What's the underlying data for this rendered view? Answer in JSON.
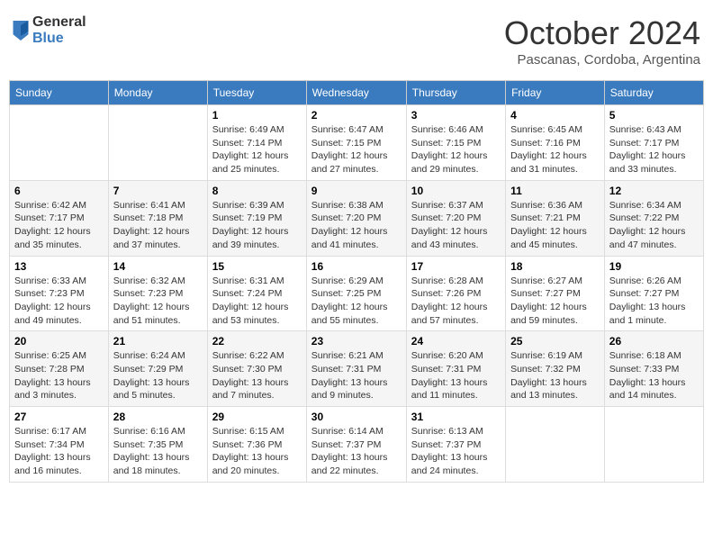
{
  "header": {
    "logo_general": "General",
    "logo_blue": "Blue",
    "month_title": "October 2024",
    "location": "Pascanas, Cordoba, Argentina"
  },
  "days_of_week": [
    "Sunday",
    "Monday",
    "Tuesday",
    "Wednesday",
    "Thursday",
    "Friday",
    "Saturday"
  ],
  "weeks": [
    [
      {
        "day": "",
        "info": ""
      },
      {
        "day": "",
        "info": ""
      },
      {
        "day": "1",
        "sunrise": "6:49 AM",
        "sunset": "7:14 PM",
        "daylight": "12 hours and 25 minutes."
      },
      {
        "day": "2",
        "sunrise": "6:47 AM",
        "sunset": "7:15 PM",
        "daylight": "12 hours and 27 minutes."
      },
      {
        "day": "3",
        "sunrise": "6:46 AM",
        "sunset": "7:15 PM",
        "daylight": "12 hours and 29 minutes."
      },
      {
        "day": "4",
        "sunrise": "6:45 AM",
        "sunset": "7:16 PM",
        "daylight": "12 hours and 31 minutes."
      },
      {
        "day": "5",
        "sunrise": "6:43 AM",
        "sunset": "7:17 PM",
        "daylight": "12 hours and 33 minutes."
      }
    ],
    [
      {
        "day": "6",
        "sunrise": "6:42 AM",
        "sunset": "7:17 PM",
        "daylight": "12 hours and 35 minutes."
      },
      {
        "day": "7",
        "sunrise": "6:41 AM",
        "sunset": "7:18 PM",
        "daylight": "12 hours and 37 minutes."
      },
      {
        "day": "8",
        "sunrise": "6:39 AM",
        "sunset": "7:19 PM",
        "daylight": "12 hours and 39 minutes."
      },
      {
        "day": "9",
        "sunrise": "6:38 AM",
        "sunset": "7:20 PM",
        "daylight": "12 hours and 41 minutes."
      },
      {
        "day": "10",
        "sunrise": "6:37 AM",
        "sunset": "7:20 PM",
        "daylight": "12 hours and 43 minutes."
      },
      {
        "day": "11",
        "sunrise": "6:36 AM",
        "sunset": "7:21 PM",
        "daylight": "12 hours and 45 minutes."
      },
      {
        "day": "12",
        "sunrise": "6:34 AM",
        "sunset": "7:22 PM",
        "daylight": "12 hours and 47 minutes."
      }
    ],
    [
      {
        "day": "13",
        "sunrise": "6:33 AM",
        "sunset": "7:23 PM",
        "daylight": "12 hours and 49 minutes."
      },
      {
        "day": "14",
        "sunrise": "6:32 AM",
        "sunset": "7:23 PM",
        "daylight": "12 hours and 51 minutes."
      },
      {
        "day": "15",
        "sunrise": "6:31 AM",
        "sunset": "7:24 PM",
        "daylight": "12 hours and 53 minutes."
      },
      {
        "day": "16",
        "sunrise": "6:29 AM",
        "sunset": "7:25 PM",
        "daylight": "12 hours and 55 minutes."
      },
      {
        "day": "17",
        "sunrise": "6:28 AM",
        "sunset": "7:26 PM",
        "daylight": "12 hours and 57 minutes."
      },
      {
        "day": "18",
        "sunrise": "6:27 AM",
        "sunset": "7:27 PM",
        "daylight": "12 hours and 59 minutes."
      },
      {
        "day": "19",
        "sunrise": "6:26 AM",
        "sunset": "7:27 PM",
        "daylight": "13 hours and 1 minute."
      }
    ],
    [
      {
        "day": "20",
        "sunrise": "6:25 AM",
        "sunset": "7:28 PM",
        "daylight": "13 hours and 3 minutes."
      },
      {
        "day": "21",
        "sunrise": "6:24 AM",
        "sunset": "7:29 PM",
        "daylight": "13 hours and 5 minutes."
      },
      {
        "day": "22",
        "sunrise": "6:22 AM",
        "sunset": "7:30 PM",
        "daylight": "13 hours and 7 minutes."
      },
      {
        "day": "23",
        "sunrise": "6:21 AM",
        "sunset": "7:31 PM",
        "daylight": "13 hours and 9 minutes."
      },
      {
        "day": "24",
        "sunrise": "6:20 AM",
        "sunset": "7:31 PM",
        "daylight": "13 hours and 11 minutes."
      },
      {
        "day": "25",
        "sunrise": "6:19 AM",
        "sunset": "7:32 PM",
        "daylight": "13 hours and 13 minutes."
      },
      {
        "day": "26",
        "sunrise": "6:18 AM",
        "sunset": "7:33 PM",
        "daylight": "13 hours and 14 minutes."
      }
    ],
    [
      {
        "day": "27",
        "sunrise": "6:17 AM",
        "sunset": "7:34 PM",
        "daylight": "13 hours and 16 minutes."
      },
      {
        "day": "28",
        "sunrise": "6:16 AM",
        "sunset": "7:35 PM",
        "daylight": "13 hours and 18 minutes."
      },
      {
        "day": "29",
        "sunrise": "6:15 AM",
        "sunset": "7:36 PM",
        "daylight": "13 hours and 20 minutes."
      },
      {
        "day": "30",
        "sunrise": "6:14 AM",
        "sunset": "7:37 PM",
        "daylight": "13 hours and 22 minutes."
      },
      {
        "day": "31",
        "sunrise": "6:13 AM",
        "sunset": "7:37 PM",
        "daylight": "13 hours and 24 minutes."
      },
      {
        "day": "",
        "info": ""
      },
      {
        "day": "",
        "info": ""
      }
    ]
  ]
}
